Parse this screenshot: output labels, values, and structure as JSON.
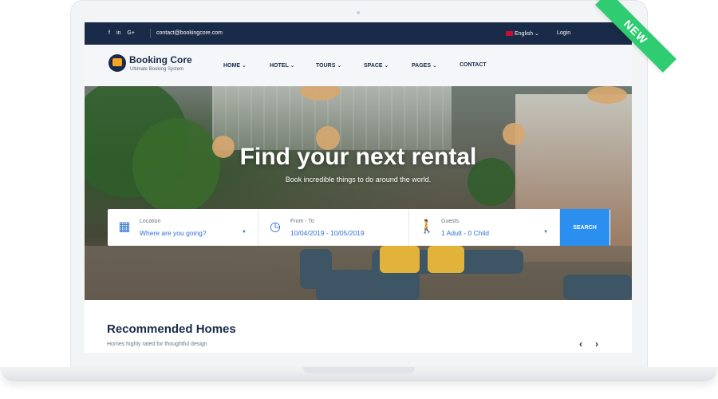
{
  "topbar": {
    "social": [
      "f",
      "in",
      "G+"
    ],
    "email": "contact@bookingcore.com",
    "language": "English",
    "login": "Login"
  },
  "brand": {
    "name": "Booking Core",
    "tagline": "Ultimate Booking System"
  },
  "menu": [
    {
      "label": "HOME",
      "dropdown": true
    },
    {
      "label": "HOTEL",
      "dropdown": true
    },
    {
      "label": "TOURS",
      "dropdown": true
    },
    {
      "label": "SPACE",
      "dropdown": true
    },
    {
      "label": "PAGES",
      "dropdown": true
    },
    {
      "label": "CONTACT",
      "dropdown": false
    }
  ],
  "hero": {
    "title": "Find your next rental",
    "subtitle": "Book incredible things to do around the world."
  },
  "search": {
    "location": {
      "label": "Location",
      "value": "Where are you going?",
      "icon": "map-icon"
    },
    "dates": {
      "label": "From - To",
      "value": "10/04/2019 - 10/05/2019",
      "icon": "clock-icon"
    },
    "guests": {
      "label": "Guests",
      "value": "1 Adult - 0 Child",
      "icon": "walker-icon"
    },
    "button": "SEARCH"
  },
  "section": {
    "title": "Recommended Homes",
    "subtitle": "Homes highly rated for thoughtful design",
    "prev": "‹",
    "next": "›"
  },
  "ribbon": "NEW",
  "colors": {
    "navy": "#1a2b49",
    "accent": "#2b8ff0",
    "ribbon": "#2fcc71"
  }
}
